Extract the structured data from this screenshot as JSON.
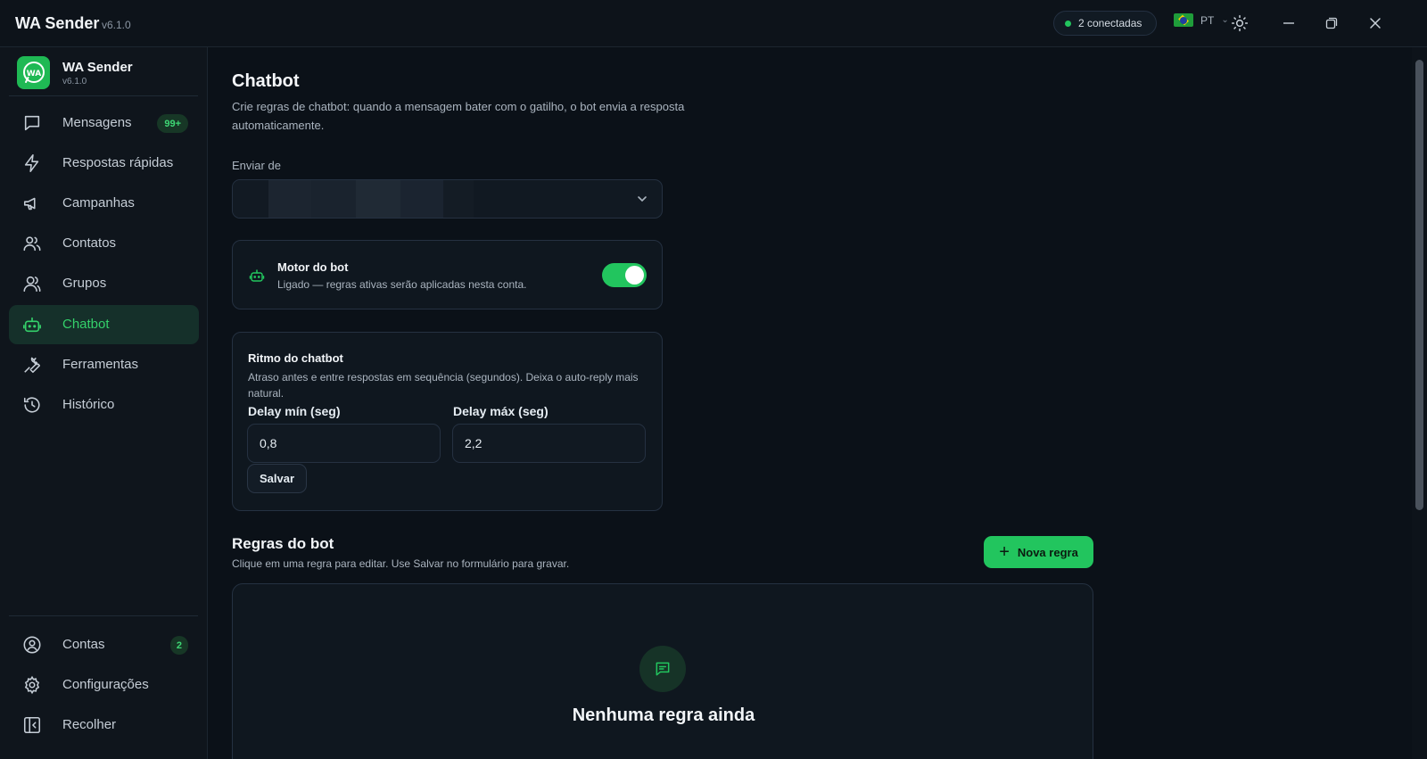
{
  "titlebar": {
    "app_title": "WA Sender",
    "version": "v6.1.0",
    "connections": "2 conectadas",
    "language": "PT"
  },
  "sidebar": {
    "brand_name": "WA Sender",
    "brand_version": "v6.1.0",
    "logo_text": "WA",
    "items": [
      {
        "label": "Mensagens",
        "badge": "99+",
        "icon": "chat-bubble-icon"
      },
      {
        "label": "Respostas rápidas",
        "icon": "lightning-icon"
      },
      {
        "label": "Campanhas",
        "icon": "megaphone-icon"
      },
      {
        "label": "Contatos",
        "icon": "users-icon"
      },
      {
        "label": "Grupos",
        "icon": "group-icon"
      },
      {
        "label": "Chatbot",
        "icon": "bot-icon",
        "active": true
      },
      {
        "label": "Ferramentas",
        "icon": "wrench-icon"
      },
      {
        "label": "Histórico",
        "icon": "history-icon"
      }
    ],
    "bottom_items": [
      {
        "label": "Contas",
        "badge": "2",
        "icon": "user-circle-icon"
      },
      {
        "label": "Configurações",
        "icon": "gear-icon"
      },
      {
        "label": "Recolher",
        "icon": "collapse-icon"
      }
    ]
  },
  "main": {
    "title": "Chatbot",
    "subtitle": "Crie regras de chatbot: quando a mensagem bater com o gatilho, o bot envia a resposta automaticamente.",
    "send_from_label": "Enviar de",
    "motor": {
      "title": "Motor do bot",
      "description": "Ligado — regras ativas serão aplicadas nesta conta.",
      "enabled": true
    },
    "rhythm": {
      "title": "Ritmo do chatbot",
      "description": "Atraso antes e entre respostas em sequência (segundos). Deixa o auto-reply mais natural.",
      "delay_min_label": "Delay mín (seg)",
      "delay_min_value": "0,8",
      "delay_max_label": "Delay máx (seg)",
      "delay_max_value": "2,2",
      "save_label": "Salvar"
    },
    "rules": {
      "title": "Regras do bot",
      "subtitle": "Clique em uma regra para editar. Use Salvar no formulário para gravar.",
      "new_rule_label": "Nova regra",
      "empty_title": "Nenhuma regra ainda"
    }
  },
  "colors": {
    "accent": "#22c55e",
    "background": "#0b1118",
    "sidebar": "#0f151c",
    "active_nav": "#15302a"
  }
}
